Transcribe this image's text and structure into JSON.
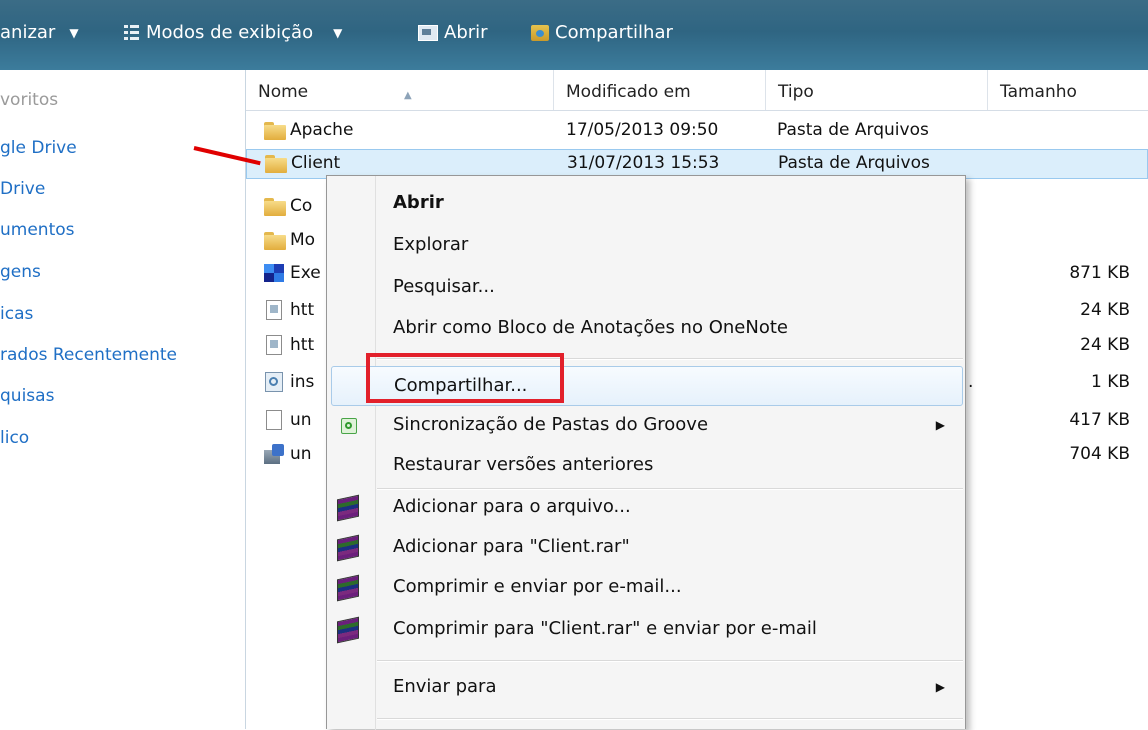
{
  "toolbar": {
    "organize": "anizar",
    "views": "Modos de exibição",
    "open": "Abrir",
    "share": "Compartilhar"
  },
  "nav": {
    "header": "voritos",
    "items": [
      "gle Drive",
      "Drive",
      "umentos",
      "gens",
      "icas",
      "rados Recentemente",
      "quisas",
      "lico"
    ]
  },
  "columns": {
    "name": "Nome",
    "modified": "Modificado em",
    "type": "Tipo",
    "size": "Tamanho"
  },
  "files": [
    {
      "name": "Apache",
      "modified": "17/05/2013 09:50",
      "type": "Pasta de Arquivos",
      "size": "",
      "icon": "folder-icon"
    },
    {
      "name": "Client",
      "modified": "31/07/2013 15:53",
      "type": "Pasta de Arquivos",
      "size": "",
      "icon": "folder-icon"
    },
    {
      "name": "Co",
      "modified": "",
      "type": "",
      "size": "",
      "icon": "folder-icon"
    },
    {
      "name": "Mo",
      "modified": "",
      "type": "",
      "size": "",
      "icon": "folder-icon"
    },
    {
      "name": "Exe",
      "modified": "",
      "type": "",
      "size": "871 KB",
      "icon": "executable-icon"
    },
    {
      "name": "htt",
      "modified": "",
      "type": "",
      "size": "24 KB",
      "icon": "document-icon"
    },
    {
      "name": "htt",
      "modified": "",
      "type": "",
      "size": "24 KB",
      "icon": "document-icon"
    },
    {
      "name": "ins",
      "modified": "",
      "type": "",
      "size": "1 KB",
      "icon": "settings-file-icon"
    },
    {
      "name": "un",
      "modified": "",
      "type": "",
      "size": "417 KB",
      "icon": "blank-file-icon"
    },
    {
      "name": "un",
      "modified": "",
      "type": "",
      "size": "704 KB",
      "icon": "installer-icon"
    }
  ],
  "truncation_dot": ".",
  "context_menu": {
    "open": "Abrir",
    "explore": "Explorar",
    "search": "Pesquisar...",
    "onenote": "Abrir como Bloco de Anotações no OneNote",
    "share": "Compartilhar...",
    "groove": "Sincronização de Pastas do Groove",
    "restore": "Restaurar versões anteriores",
    "add_archive": "Adicionar para o arquivo...",
    "add_rar": "Adicionar para \"Client.rar\"",
    "compress_email": "Comprimir e enviar por e-mail...",
    "compress_rar_email": "Comprimir para \"Client.rar\" e enviar por e-mail",
    "send_to": "Enviar para"
  },
  "colors": {
    "toolbar": "#2f6582",
    "nav_link": "#1f6fc5",
    "selection": "#dbeefb",
    "annotation_red": "#e2202b"
  }
}
